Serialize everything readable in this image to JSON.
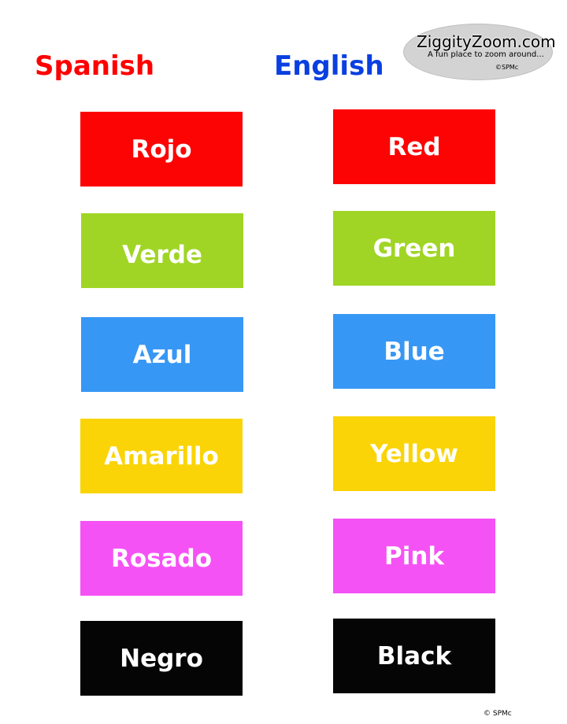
{
  "logo": {
    "name": "ZiggityZoom.com",
    "tagline": "A fun place to zoom around...",
    "copyright": "©SPMc"
  },
  "headings": {
    "spanish": "Spanish",
    "english": "English",
    "spanish_color": "#fe0000",
    "english_color": "#0a3fe0"
  },
  "colors": [
    {
      "spanish": "Rojo",
      "english": "Red",
      "hex": "#fd0404"
    },
    {
      "spanish": "Verde",
      "english": "Green",
      "hex": "#a0d525"
    },
    {
      "spanish": "Azul",
      "english": "Blue",
      "hex": "#3797f5"
    },
    {
      "spanish": "Amarillo",
      "english": "Yellow",
      "hex": "#fad406"
    },
    {
      "spanish": "Rosado",
      "english": "Pink",
      "hex": "#f552f5"
    },
    {
      "spanish": "Negro",
      "english": "Black",
      "hex": "#050505"
    }
  ],
  "footer": "©  SPMc"
}
